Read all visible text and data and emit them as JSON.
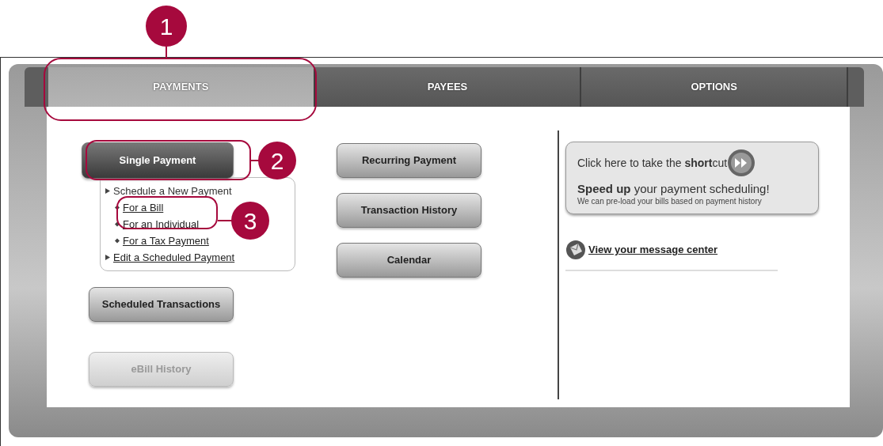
{
  "tabs": [
    {
      "label": "PAYMENTS",
      "selected": true
    },
    {
      "label": "PAYEES",
      "selected": false
    },
    {
      "label": "OPTIONS",
      "selected": false
    }
  ],
  "left_buttons": [
    {
      "label": "Single Payment",
      "selected": true,
      "disabled": false
    },
    {
      "label": "Scheduled Transactions",
      "selected": false,
      "disabled": false
    },
    {
      "label": "eBill History",
      "selected": false,
      "disabled": true
    }
  ],
  "submenu": [
    {
      "label": "Schedule a New Payment",
      "link": false,
      "children": [
        {
          "label": "For a Bill",
          "link": true
        },
        {
          "label": "For an Individual",
          "link": true
        },
        {
          "label": "For a Tax Payment",
          "link": true
        }
      ]
    },
    {
      "label": "Edit a Scheduled Payment",
      "link": true
    }
  ],
  "middle_buttons": [
    {
      "label": "Recurring Payment"
    },
    {
      "label": "Transaction History"
    },
    {
      "label": "Calendar"
    }
  ],
  "shortcut": {
    "prompt": "Click here to take the **short**cut",
    "headline": "**Speed up** your payment scheduling!",
    "note": "We can pre-load your bills based on payment history"
  },
  "message_link": "View your message center",
  "callouts": [
    {
      "label": "1"
    },
    {
      "label": "2"
    },
    {
      "label": "3"
    }
  ]
}
